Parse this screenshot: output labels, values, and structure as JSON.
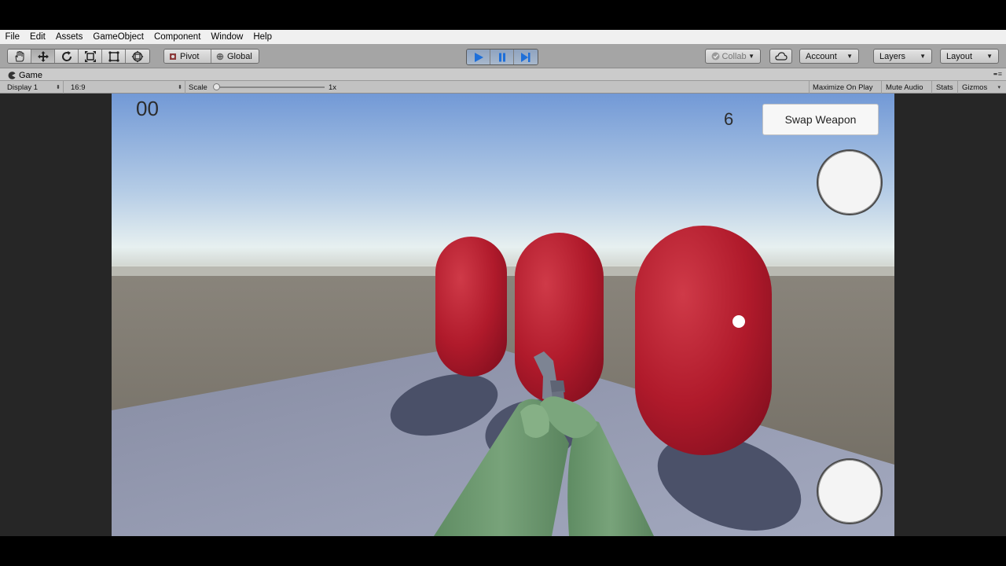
{
  "menu": {
    "items": [
      "File",
      "Edit",
      "Assets",
      "GameObject",
      "Component",
      "Window",
      "Help"
    ]
  },
  "toolbar": {
    "tools": [
      "hand-icon",
      "move-icon",
      "rotate-icon",
      "scale-icon",
      "rect-icon",
      "transform-icon"
    ],
    "pivot_label": "Pivot",
    "global_label": "Global",
    "play_controls": [
      "play-icon",
      "pause-icon",
      "step-icon"
    ],
    "collab_label": "Collab",
    "account_label": "Account",
    "layers_label": "Layers",
    "layout_label": "Layout"
  },
  "game_tab": {
    "title": "Game"
  },
  "game_options": {
    "display": "Display 1",
    "aspect": "16:9",
    "scale_label": "Scale",
    "scale_value": "1x",
    "maximize_on_play": "Maximize On Play",
    "mute_audio": "Mute Audio",
    "stats": "Stats",
    "gizmos": "Gizmos"
  },
  "hud": {
    "score": "00",
    "ammo": "6",
    "swap_weapon": "Swap Weapon"
  },
  "colors": {
    "toolbar_bg": "#a5a5a5",
    "play_active": "#1e6fd9",
    "capsule_red": "#b0182a",
    "arm_green": "#6f9a71",
    "sky_top": "#7a9ed8",
    "ground": "#7e7a72",
    "floor": "#9aa0b4"
  }
}
